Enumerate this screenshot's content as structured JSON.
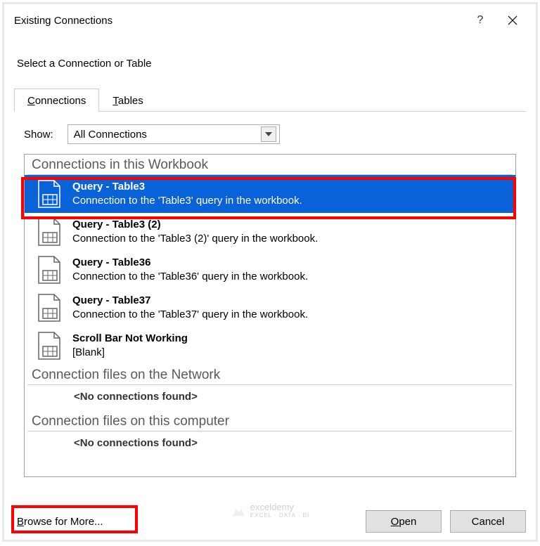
{
  "titlebar": {
    "title": "Existing Connections"
  },
  "subtitle": "Select a Connection or Table",
  "tabs": {
    "connections": "onnections",
    "tables": "ables"
  },
  "show": {
    "label": "how:",
    "selected": "All Connections"
  },
  "sections": {
    "workbook_header": "Connections in this Workbook",
    "network_header": "Connection files on the Network",
    "computer_header": "Connection files on this computer",
    "no_conn": "<No connections found>"
  },
  "items": [
    {
      "title": "Query - Table3",
      "desc": "Connection to the 'Table3' query in the workbook."
    },
    {
      "title": "Query - Table3 (2)",
      "desc": "Connection to the 'Table3 (2)' query in the workbook."
    },
    {
      "title": "Query - Table36",
      "desc": "Connection to the 'Table36' query in the workbook."
    },
    {
      "title": "Query - Table37",
      "desc": "Connection to the 'Table37' query in the workbook."
    },
    {
      "title": "Scroll Bar Not Working",
      "desc": "[Blank]"
    }
  ],
  "footer": {
    "browse": "rowse for More...",
    "open": "pen",
    "cancel": "Cancel"
  },
  "watermark": {
    "text": "exceldemy",
    "sub": "EXCEL · DATA · BI"
  }
}
